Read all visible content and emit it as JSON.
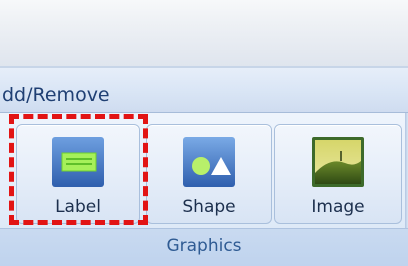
{
  "ribbon": {
    "add_remove_label": "dd/Remove",
    "group_caption": "Graphics",
    "buttons": [
      {
        "label": "Label",
        "icon": "label-icon"
      },
      {
        "label": "Shape",
        "icon": "shape-icon"
      },
      {
        "label": "Image",
        "icon": "image-icon"
      }
    ]
  },
  "colors": {
    "highlight": "#e21414",
    "icon_green": "#9ef04e",
    "icon_blue": "#3f78c9"
  }
}
